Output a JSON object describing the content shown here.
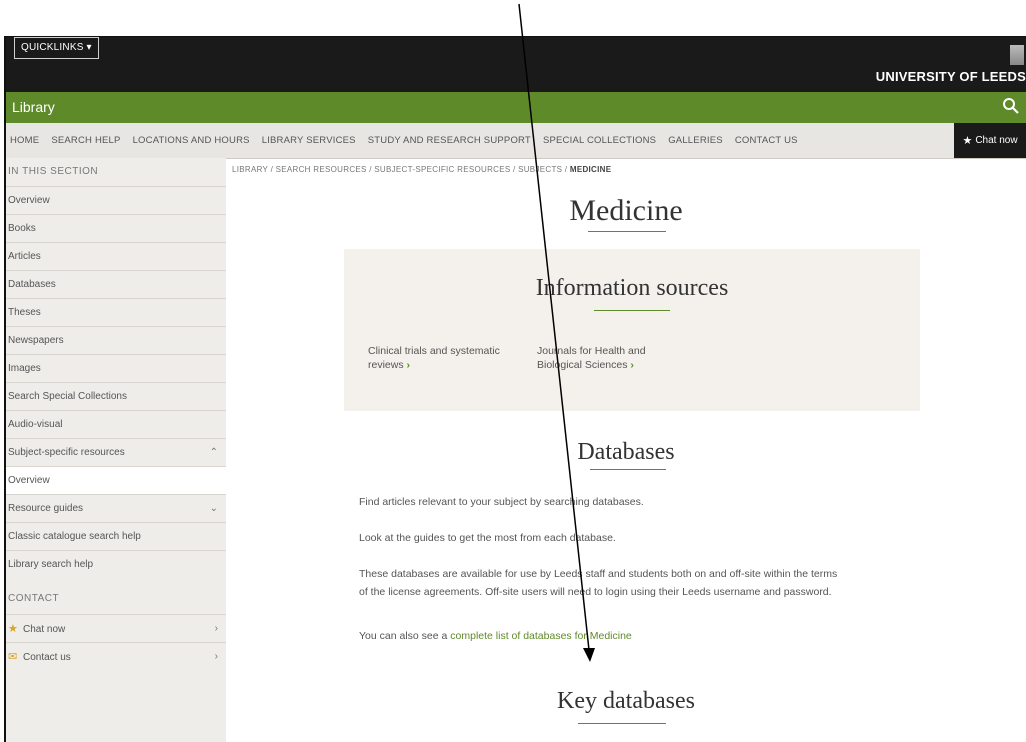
{
  "topbar": {
    "quicklinks_label": "QUICKLINKS ▾",
    "university_name": "UNIVERSITY OF LEEDS"
  },
  "library_bar": {
    "title": "Library"
  },
  "nav": {
    "items": [
      "HOME",
      "SEARCH HELP",
      "LOCATIONS AND HOURS",
      "LIBRARY SERVICES",
      "STUDY AND RESEARCH SUPPORT",
      "SPECIAL COLLECTIONS",
      "GALLERIES",
      "CONTACT US"
    ],
    "chat_label": "Chat now"
  },
  "sidebar": {
    "heading": "IN THIS SECTION",
    "items": [
      {
        "label": "Overview"
      },
      {
        "label": "Books"
      },
      {
        "label": "Articles"
      },
      {
        "label": "Databases"
      },
      {
        "label": "Theses"
      },
      {
        "label": "Newspapers"
      },
      {
        "label": "Images"
      },
      {
        "label": "Search Special Collections"
      },
      {
        "label": "Audio-visual"
      },
      {
        "label": "Subject-specific resources",
        "chevron": "^"
      },
      {
        "label": "Overview",
        "active": true
      },
      {
        "label": "Resource guides",
        "chevron": "v"
      },
      {
        "label": "Classic catalogue search help"
      },
      {
        "label": "Library search help"
      }
    ],
    "contact_heading": "CONTACT",
    "contact_items": [
      {
        "label": "Chat now",
        "icon": "star-icon"
      },
      {
        "label": "Contact us",
        "icon": "envelope-icon"
      }
    ]
  },
  "breadcrumb": {
    "parts": [
      "LIBRARY",
      "SEARCH RESOURCES",
      "SUBJECT-SPECIFIC RESOURCES",
      "SUBJECTS"
    ],
    "current": "MEDICINE",
    "separator": " / "
  },
  "content": {
    "title": "Medicine",
    "info_title": "Information sources",
    "info_links": [
      {
        "line1": "Clinical trials and systematic",
        "line2": "reviews"
      },
      {
        "line1": "Journals for Health and",
        "line2": "Biological Sciences"
      }
    ],
    "databases_title": "Databases",
    "para1": "Find articles relevant to your subject by searching databases.",
    "para2": "Look at the guides to get the most from each database.",
    "para3a": "These databases are available for use by Leeds staff and students both on and off-site within the terms",
    "para3b": "of the license agreements. Off-site users will need to login using their Leeds username and password.",
    "para4_prefix": "You can also see a ",
    "para4_link": "complete list of databases for Medicine",
    "key_title": "Key databases"
  },
  "colors": {
    "brand_green": "#5f8a2a",
    "topbar": "#1a1a1a",
    "sidebar_bg": "#efedea",
    "info_bg": "#f4f1ec"
  }
}
